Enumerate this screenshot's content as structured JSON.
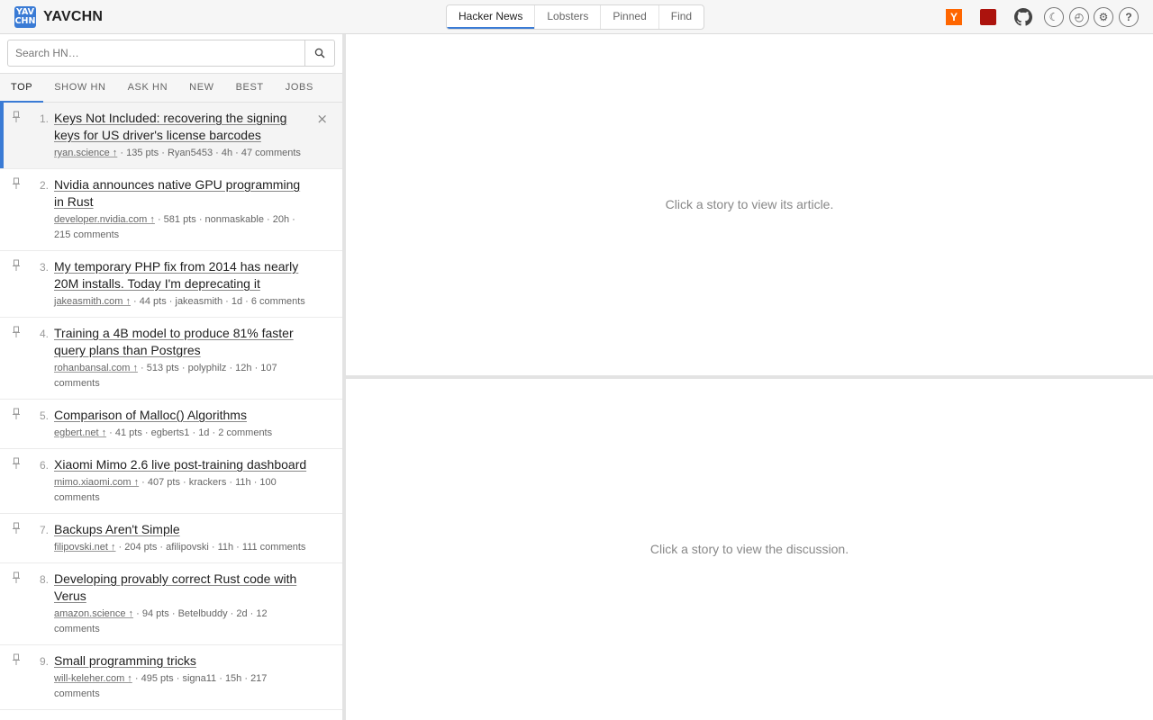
{
  "app": {
    "logo_line1": "YAV",
    "logo_line2": "CHN",
    "title": "YAVCHN"
  },
  "source_tabs": [
    {
      "label": "Hacker News",
      "active": true
    },
    {
      "label": "Lobsters",
      "active": false
    },
    {
      "label": "Pinned",
      "active": false
    },
    {
      "label": "Find",
      "active": false
    }
  ],
  "header_icons": {
    "hn": "Y",
    "moon": "☾",
    "clock": "◴",
    "gear": "⚙",
    "help": "?"
  },
  "search": {
    "placeholder": "Search HN…",
    "value": ""
  },
  "sub_tabs": [
    {
      "label": "TOP",
      "active": true
    },
    {
      "label": "SHOW HN",
      "active": false
    },
    {
      "label": "ASK HN",
      "active": false
    },
    {
      "label": "NEW",
      "active": false
    },
    {
      "label": "BEST",
      "active": false
    },
    {
      "label": "JOBS",
      "active": false
    }
  ],
  "stories": [
    {
      "num": "1.",
      "title": "Keys Not Included: recovering the signing keys for US driver's license barcodes",
      "domain": "ryan.science ↑",
      "details": " · 135 pts · Ryan5453 · 4h · 47 comments",
      "selected": true
    },
    {
      "num": "2.",
      "title": "Nvidia announces native GPU programming in Rust",
      "domain": "developer.nvidia.com ↑",
      "details": " · 581 pts · nonmaskable · 20h · 215 comments",
      "selected": false
    },
    {
      "num": "3.",
      "title": "My temporary PHP fix from 2014 has nearly 20M installs. Today I'm deprecating it",
      "domain": "jakeasmith.com ↑",
      "details": " · 44 pts · jakeasmith · 1d · 6 comments",
      "selected": false
    },
    {
      "num": "4.",
      "title": "Training a 4B model to produce 81% faster query plans than Postgres",
      "domain": "rohanbansal.com ↑",
      "details": " · 513 pts · polyphilz · 12h · 107 comments",
      "selected": false
    },
    {
      "num": "5.",
      "title": "Comparison of Malloc() Algorithms",
      "domain": "egbert.net ↑",
      "details": " · 41 pts · egberts1 · 1d · 2 comments",
      "selected": false
    },
    {
      "num": "6.",
      "title": "Xiaomi Mimo 2.6 live post-training dashboard",
      "domain": "mimo.xiaomi.com ↑",
      "details": " · 407 pts · krackers · 11h · 100 comments",
      "selected": false
    },
    {
      "num": "7.",
      "title": "Backups Aren't Simple",
      "domain": "filipovski.net ↑",
      "details": " · 204 pts · afilipovski · 11h · 111 comments",
      "selected": false
    },
    {
      "num": "8.",
      "title": "Developing provably correct Rust code with Verus",
      "domain": "amazon.science ↑",
      "details": " · 94 pts · Betelbuddy · 2d · 12 comments",
      "selected": false
    },
    {
      "num": "9.",
      "title": "Small programming tricks",
      "domain": "will-keleher.com ↑",
      "details": " · 495 pts · signa11 · 15h · 217 comments",
      "selected": false
    }
  ],
  "dismiss_glyph": "×",
  "article_placeholder": "Click a story to view its article.",
  "discussion_placeholder": "Click a story to view the discussion.",
  "colors": {
    "accent": "#3a7bd5",
    "hn_orange": "#ff6600",
    "lobsters_red": "#ac130d"
  }
}
